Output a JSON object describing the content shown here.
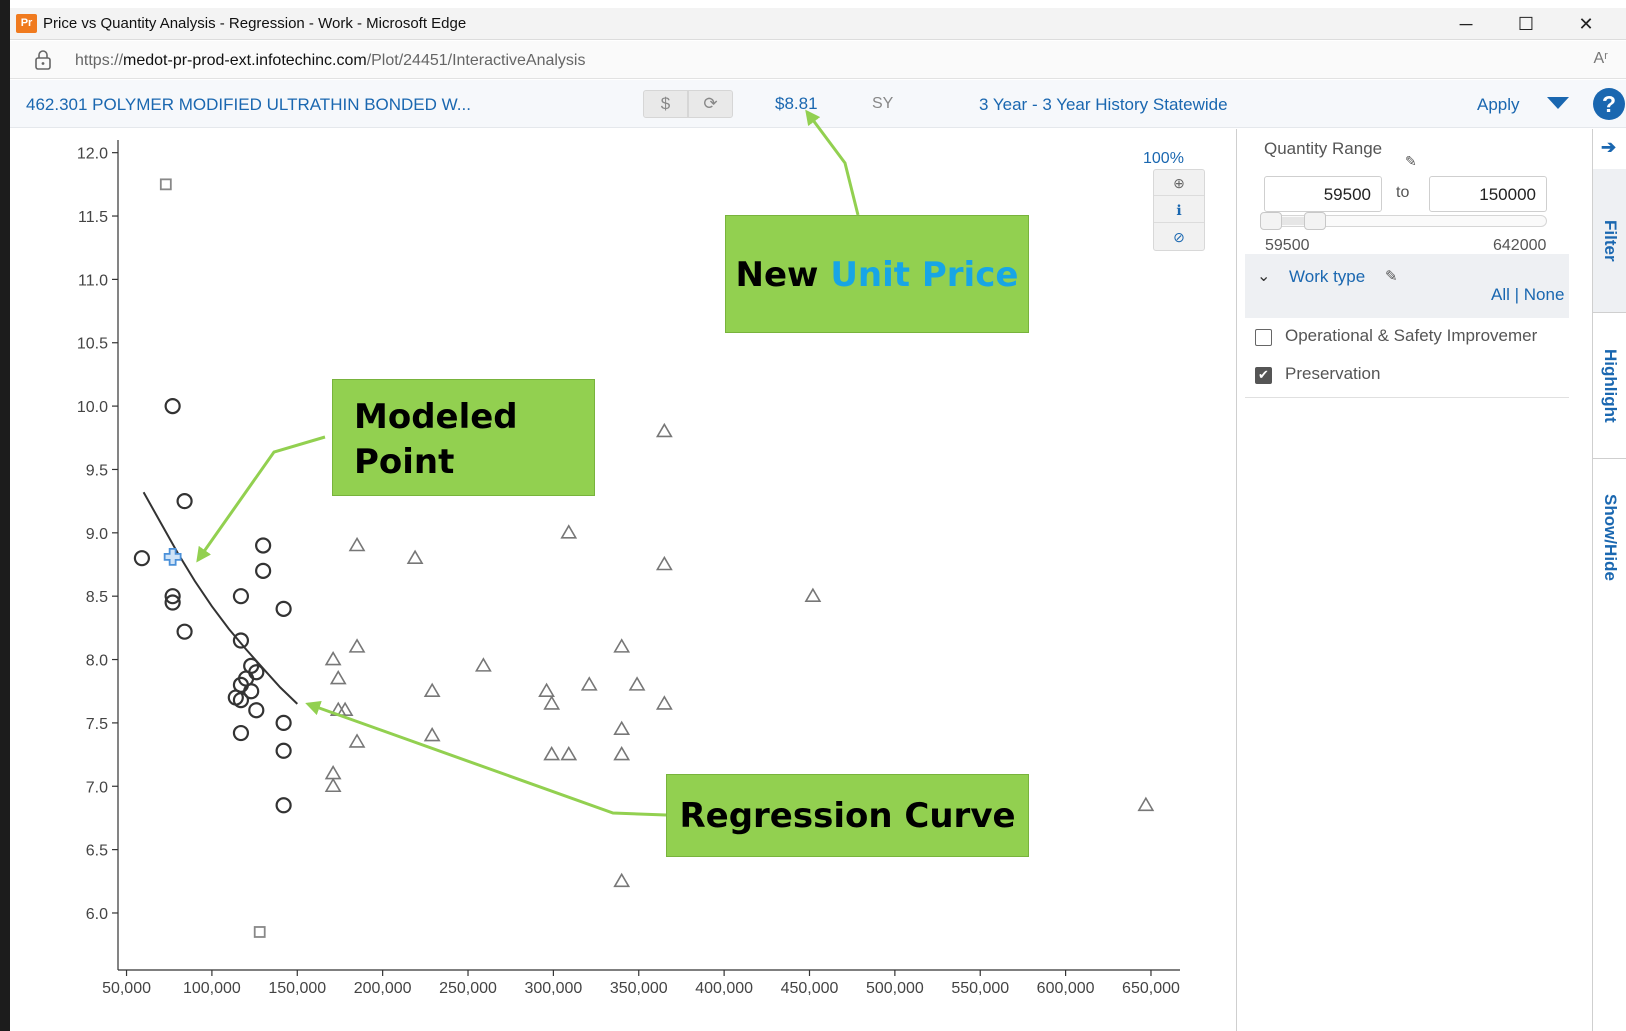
{
  "window": {
    "app_icon": "Pr",
    "title": "Price vs Quantity Analysis - Regression - Work - Microsoft Edge",
    "minimize": "─",
    "maximize": "☐",
    "close": "✕"
  },
  "address": {
    "prefix": "https://",
    "host": "medot-pr-prod-ext.infotechinc.com",
    "path": "/Plot/24451/InteractiveAnalysis",
    "read_aloud_icon": "Aʳ"
  },
  "header": {
    "item_title": "462.301 POLYMER MODIFIED ULTRATHIN BONDED W...",
    "dollar_label": "$",
    "refresh_label": "⟳",
    "unit_price": "$8.81",
    "unit": "SY",
    "history": "3 Year - 3 Year History Statewide",
    "apply_label": "Apply",
    "help_label": "?"
  },
  "zoom": {
    "percent": "100%",
    "zoom_in_icon": "⊕",
    "info_icon": "ℹ",
    "reset_icon": "⊘"
  },
  "filter_panel": {
    "quantity_range_label": "Quantity Range",
    "edit_icon": "✎",
    "min_value": "59500",
    "to_label": "to",
    "max_value": "150000",
    "slider_min_label": "59500",
    "slider_max_label": "642000",
    "work_type_chevron": "⌄",
    "work_type_label": "Work type",
    "all_none": "All | None",
    "options": [
      {
        "label": "Operational & Safety Improvemer",
        "checked": false,
        "mark": ""
      },
      {
        "label": "Preservation",
        "checked": true,
        "mark": "✔"
      }
    ]
  },
  "side_tabs": {
    "arrow": "➔",
    "filter": "Filter",
    "highlight": "Highlight",
    "show_hide": "Show/Hide"
  },
  "callouts": {
    "new_prefix": "New ",
    "unit_price": "Unit Price",
    "modeled_line1": "Modeled",
    "modeled_line2": "Point",
    "regression": "Regression Curve"
  },
  "chart_data": {
    "type": "scatter",
    "title": "",
    "xlabel": "",
    "ylabel": "",
    "xlim": [
      45000,
      667000
    ],
    "ylim": [
      5.55,
      12.1
    ],
    "x_ticks": [
      50000,
      100000,
      150000,
      200000,
      250000,
      300000,
      350000,
      400000,
      450000,
      500000,
      550000,
      600000,
      650000
    ],
    "x_tick_labels": [
      "50,000",
      "100,000",
      "150,000",
      "200,000",
      "250,000",
      "300,000",
      "350,000",
      "400,000",
      "450,000",
      "500,000",
      "550,000",
      "600,000",
      "650,000"
    ],
    "y_ticks": [
      6.0,
      6.5,
      7.0,
      7.5,
      8.0,
      8.5,
      9.0,
      9.5,
      10.0,
      10.5,
      11.0,
      11.5,
      12.0
    ],
    "y_tick_labels": [
      "6.0",
      "6.5",
      "7.0",
      "7.5",
      "8.0",
      "8.5",
      "9.0",
      "9.5",
      "10.0",
      "10.5",
      "11.0",
      "11.5",
      "12.0"
    ],
    "series": [
      {
        "marker": "circle",
        "color": "#333333",
        "points": [
          [
            77000,
            10.0
          ],
          [
            84000,
            9.25
          ],
          [
            59000,
            8.8
          ],
          [
            77000,
            8.5
          ],
          [
            77000,
            8.45
          ],
          [
            84000,
            8.22
          ],
          [
            130000,
            8.9
          ],
          [
            130000,
            8.7
          ],
          [
            117000,
            8.5
          ],
          [
            142000,
            8.4
          ],
          [
            117000,
            8.15
          ],
          [
            123000,
            7.95
          ],
          [
            126000,
            7.9
          ],
          [
            120000,
            7.85
          ],
          [
            117000,
            7.8
          ],
          [
            123000,
            7.75
          ],
          [
            114000,
            7.7
          ],
          [
            117000,
            7.68
          ],
          [
            126000,
            7.6
          ],
          [
            142000,
            7.5
          ],
          [
            117000,
            7.42
          ],
          [
            142000,
            7.28
          ],
          [
            142000,
            6.85
          ]
        ]
      },
      {
        "marker": "triangle",
        "color": "#777777",
        "points": [
          [
            365000,
            9.8
          ],
          [
            309000,
            9.0
          ],
          [
            185000,
            8.9
          ],
          [
            219000,
            8.8
          ],
          [
            365000,
            8.75
          ],
          [
            452000,
            8.5
          ],
          [
            185000,
            8.1
          ],
          [
            340000,
            8.1
          ],
          [
            171000,
            8.0
          ],
          [
            259000,
            7.95
          ],
          [
            174000,
            7.85
          ],
          [
            321000,
            7.8
          ],
          [
            349000,
            7.8
          ],
          [
            229000,
            7.75
          ],
          [
            296000,
            7.75
          ],
          [
            365000,
            7.65
          ],
          [
            299000,
            7.65
          ],
          [
            174000,
            7.6
          ],
          [
            178000,
            7.6
          ],
          [
            340000,
            7.45
          ],
          [
            229000,
            7.4
          ],
          [
            185000,
            7.35
          ],
          [
            299000,
            7.25
          ],
          [
            309000,
            7.25
          ],
          [
            340000,
            7.25
          ],
          [
            171000,
            7.1
          ],
          [
            171000,
            7.0
          ],
          [
            647000,
            6.85
          ],
          [
            340000,
            6.25
          ]
        ]
      },
      {
        "marker": "square",
        "color": "#888888",
        "points": [
          [
            73000,
            11.75
          ],
          [
            128000,
            5.85
          ]
        ]
      }
    ],
    "modeled_point": {
      "x": 77000,
      "y": 8.81,
      "marker": "plus",
      "color": "#4a90d9"
    },
    "regression_curve": [
      [
        60000,
        9.32
      ],
      [
        70000,
        9.08
      ],
      [
        80000,
        8.84
      ],
      [
        90000,
        8.62
      ],
      [
        100000,
        8.42
      ],
      [
        110000,
        8.24
      ],
      [
        120000,
        8.08
      ],
      [
        130000,
        7.93
      ],
      [
        140000,
        7.78
      ],
      [
        150000,
        7.65
      ]
    ]
  }
}
